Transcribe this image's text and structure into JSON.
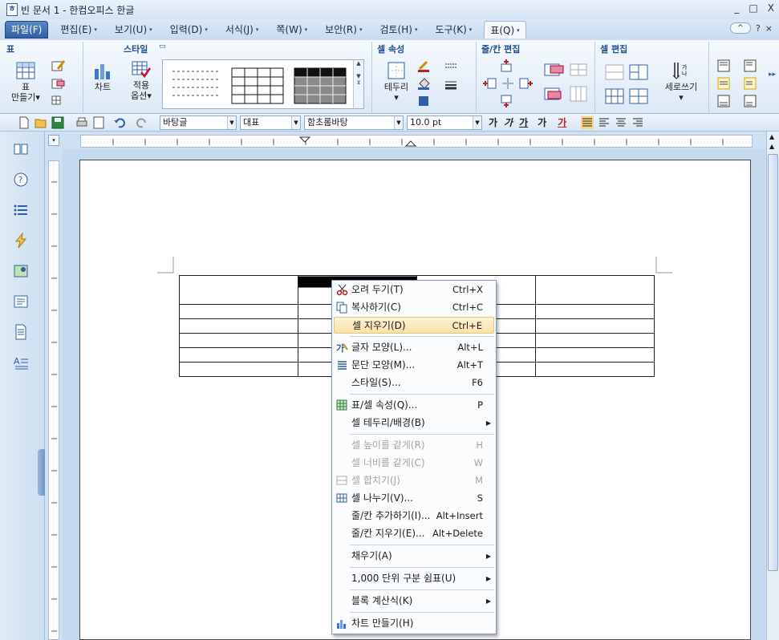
{
  "window": {
    "title": "빈 문서 1 - 한컴오피스 한글",
    "controls": [
      "_",
      "□",
      "X"
    ]
  },
  "menubar": {
    "items": [
      {
        "label": "파일(F)",
        "arrow": ""
      },
      {
        "label": "편집(E)",
        "arrow": "▾"
      },
      {
        "label": "보기(U)",
        "arrow": "▾"
      },
      {
        "label": "입력(D)",
        "arrow": "▾"
      },
      {
        "label": "서식(J)",
        "arrow": "▾"
      },
      {
        "label": "쪽(W)",
        "arrow": "▾"
      },
      {
        "label": "보안(R)",
        "arrow": "▾"
      },
      {
        "label": "검토(H)",
        "arrow": "▾"
      },
      {
        "label": "도구(K)",
        "arrow": "▾"
      },
      {
        "label": "표(Q)",
        "arrow": "▾"
      }
    ],
    "right": {
      "collapse": "^",
      "help": "?",
      "close": "×"
    }
  },
  "ribbon": {
    "groups": {
      "table": "표",
      "style": "스타일",
      "cell_props": "셀 속성",
      "row_col_edit": "줄/칸 편집",
      "cell_edit": "셀 편집"
    },
    "buttons": {
      "make_table_1": "표",
      "make_table_2": "만들기",
      "chart": "차트",
      "apply_options_1": "적용",
      "apply_options_2": "옵션",
      "border": "테두리",
      "vertical_writing": "세로쓰기"
    }
  },
  "toolbar": {
    "style_combo": "바탕글",
    "outline_combo": "대표",
    "font_combo": "함초롬바탕",
    "size_combo": "10.0",
    "size_unit": "pt",
    "bold": "가",
    "italic": "가",
    "underline": "가",
    "strike": "가",
    "color": "가"
  },
  "document": {
    "table": {
      "rows": 7,
      "cols": 4
    }
  },
  "context_menu": {
    "items": [
      {
        "label": "오려 두기(T)",
        "shortcut": "Ctrl+X",
        "icon": "scissors-icon",
        "enabled": true
      },
      {
        "label": "복사하기(C)",
        "shortcut": "Ctrl+C",
        "icon": "copy-icon",
        "enabled": true
      },
      {
        "label": "셀 지우기(D)",
        "shortcut": "Ctrl+E",
        "icon": "",
        "enabled": true,
        "highlighted": true
      },
      {
        "label": "글자 모양(L)...",
        "shortcut": "Alt+L",
        "icon": "char-shape-icon",
        "enabled": true
      },
      {
        "label": "문단 모양(M)...",
        "shortcut": "Alt+T",
        "icon": "paragraph-shape-icon",
        "enabled": true
      },
      {
        "label": "스타일(S)...",
        "shortcut": "F6",
        "icon": "",
        "enabled": true
      },
      {
        "label": "표/셀 속성(Q)...",
        "shortcut": "P",
        "icon": "table-props-icon",
        "enabled": true
      },
      {
        "label": "셀 테두리/배경(B)",
        "shortcut": "",
        "submenu": true,
        "icon": "",
        "enabled": true
      },
      {
        "label": "셀 높이를 같게(R)",
        "shortcut": "H",
        "icon": "",
        "enabled": false
      },
      {
        "label": "셀 너비를 같게(C)",
        "shortcut": "W",
        "icon": "",
        "enabled": false
      },
      {
        "label": "셀 합치기(J)",
        "shortcut": "M",
        "icon": "merge-cells-icon",
        "enabled": false
      },
      {
        "label": "셀 나누기(V)...",
        "shortcut": "S",
        "icon": "split-cells-icon",
        "enabled": true
      },
      {
        "label": "줄/칸 추가하기(I)...",
        "shortcut": "Alt+Insert",
        "icon": "",
        "enabled": true
      },
      {
        "label": "줄/칸 지우기(E)...",
        "shortcut": "Alt+Delete",
        "icon": "",
        "enabled": true
      },
      {
        "label": "채우기(A)",
        "shortcut": "",
        "submenu": true,
        "icon": "",
        "enabled": true
      },
      {
        "label": "1,000 단위 구분 쉼표(U)",
        "shortcut": "",
        "submenu": true,
        "icon": "",
        "enabled": true
      },
      {
        "label": "블록 계산식(K)",
        "shortcut": "",
        "submenu": true,
        "icon": "",
        "enabled": true
      },
      {
        "label": "차트 만들기(H)",
        "shortcut": "",
        "icon": "chart-icon",
        "enabled": true
      }
    ]
  },
  "colors": {
    "accent": "#2f5fa6",
    "highlight": "#f8e2a8",
    "ribbon_title": "#1f4f8c"
  }
}
